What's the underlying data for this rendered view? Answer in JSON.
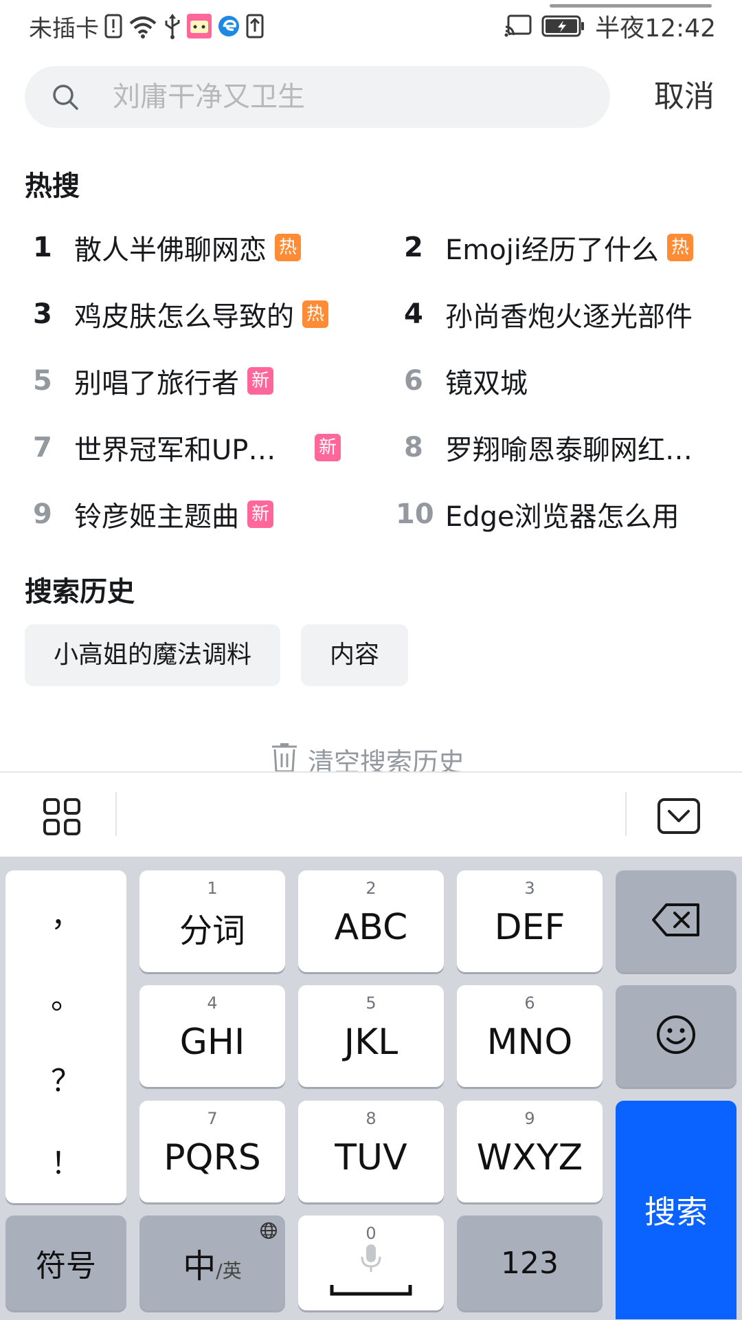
{
  "status_bar": {
    "left_text": "未插卡",
    "icons": [
      "warning-icon",
      "wifi-icon",
      "usb-icon",
      "bilibili-icon",
      "edge-icon",
      "upload-icon"
    ],
    "right_icons": [
      "cast-icon",
      "battery-icon"
    ],
    "time": "半夜12:42"
  },
  "search": {
    "placeholder": "刘庸干净又卫生",
    "cancel_label": "取消"
  },
  "hot_search": {
    "title": "热搜",
    "items": [
      {
        "rank": "1",
        "text": "散人半佛聊网恋",
        "tag": "热",
        "tag_type": "hot"
      },
      {
        "rank": "2",
        "text": "Emoji经历了什么",
        "tag": "热",
        "tag_type": "hot"
      },
      {
        "rank": "3",
        "text": "鸡皮肤怎么导致的",
        "tag": "热",
        "tag_type": "hot"
      },
      {
        "rank": "4",
        "text": "孙尚香炮火逐光部件",
        "tag": "",
        "tag_type": ""
      },
      {
        "rank": "5",
        "text": "别唱了旅行者",
        "tag": "新",
        "tag_type": "new"
      },
      {
        "rank": "6",
        "text": "镜双城",
        "tag": "",
        "tag_type": ""
      },
      {
        "rank": "7",
        "text": "世界冠军和UP…",
        "tag": "新",
        "tag_type": "new"
      },
      {
        "rank": "8",
        "text": "罗翔喻恩泰聊网红…",
        "tag": "",
        "tag_type": ""
      },
      {
        "rank": "9",
        "text": "铃彦姬主题曲",
        "tag": "新",
        "tag_type": "new"
      },
      {
        "rank": "10",
        "text": "Edge浏览器怎么用",
        "tag": "",
        "tag_type": ""
      }
    ]
  },
  "history": {
    "title": "搜索历史",
    "items": [
      "小高姐的魔法调料",
      "内容"
    ],
    "clear_label": "清空搜索历史"
  },
  "keyboard": {
    "punctuation": [
      "，",
      "。",
      "？",
      "！"
    ],
    "keys": [
      {
        "num": "1",
        "label": "分词"
      },
      {
        "num": "2",
        "label": "ABC"
      },
      {
        "num": "3",
        "label": "DEF"
      },
      {
        "num": "4",
        "label": "GHI"
      },
      {
        "num": "5",
        "label": "JKL"
      },
      {
        "num": "6",
        "label": "MNO"
      },
      {
        "num": "7",
        "label": "PQRS"
      },
      {
        "num": "8",
        "label": "TUV"
      },
      {
        "num": "9",
        "label": "WXYZ"
      }
    ],
    "symbol_label": "符号",
    "lang_main": "中",
    "lang_sub": "/英",
    "space_num": "0",
    "num_label": "123",
    "search_label": "搜索"
  },
  "colors": {
    "accent_blue": "#0b63ff",
    "tag_hot": "#ff8b35",
    "tag_new": "#ff6699"
  }
}
